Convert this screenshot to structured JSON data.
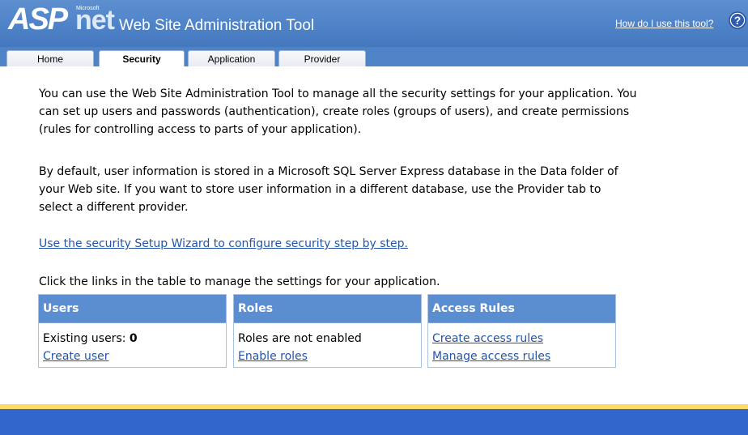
{
  "header": {
    "logo_asp": "ASP",
    "logo_net": "net",
    "logo_microsoft": "Microsoft",
    "title": "Web Site Administration Tool",
    "help_link": "How do I use this tool?",
    "help_icon": "question-mark-icon"
  },
  "tabs": [
    {
      "label": "Home",
      "active": false
    },
    {
      "label": "Security",
      "active": true
    },
    {
      "label": "Application",
      "active": false
    },
    {
      "label": "Provider",
      "active": false
    }
  ],
  "main": {
    "paragraph1": "You can use the Web Site Administration Tool to manage all the security settings for your application. You can set up users and passwords (authentication), create roles (groups of users), and create permissions (rules for controlling access to parts of your application).",
    "paragraph2": "By default, user information is stored in a Microsoft SQL Server Express database in the Data folder of your Web site. If you want to store user information in a different database, use the Provider tab to select a different provider.",
    "wizard_link": "Use the security Setup Wizard to configure security step by step.",
    "table_intro": "Click the links in the table to manage the settings for your application."
  },
  "panels": {
    "users": {
      "header": "Users",
      "existing_label": "Existing users:",
      "existing_count": "0",
      "create_link": "Create user"
    },
    "roles": {
      "header": "Roles",
      "status": "Roles are not enabled",
      "enable_link": "Enable roles"
    },
    "access": {
      "header": "Access Rules",
      "create_link": "Create access rules",
      "manage_link": "Manage access rules"
    }
  },
  "colors": {
    "header_blue": "#4f83c8",
    "panel_header": "#5b8dd1",
    "link": "#2255aa",
    "footer_accent": "#ffd966",
    "footer": "#3366cc"
  }
}
